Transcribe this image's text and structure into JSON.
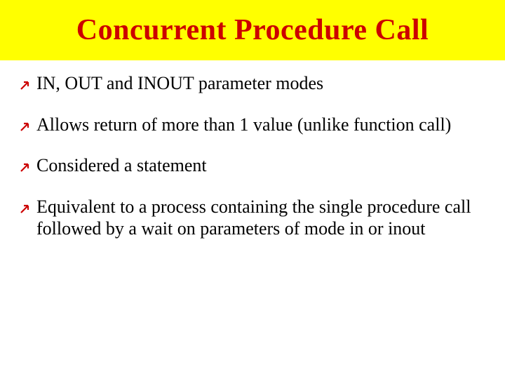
{
  "title": "Concurrent Procedure Call",
  "bullets": [
    {
      "text": "IN, OUT and INOUT parameter modes"
    },
    {
      "text": "Allows return of more than 1 value (unlike function call)"
    },
    {
      "text": "Considered a statement"
    },
    {
      "text": "Equivalent to a process containing the single procedure call followed by a wait on parameters of mode in or inout"
    }
  ],
  "icon": {
    "name": "upright-arrow-icon",
    "color": "#cc0000"
  }
}
